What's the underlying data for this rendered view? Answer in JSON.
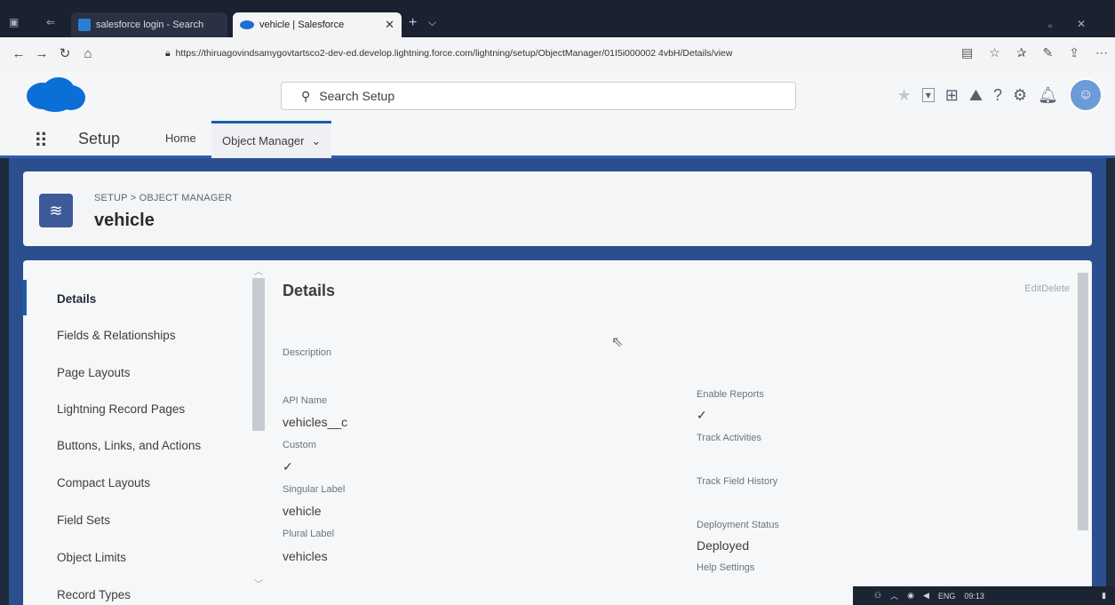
{
  "browser": {
    "tabs": [
      {
        "label": "salesforce login - Search",
        "active": false
      },
      {
        "label": "vehicle | Salesforce",
        "active": true
      }
    ],
    "new_tab": "+",
    "url": "https://thiruagovindsamygovtartsco2-dev-ed.develop.lightning.force.com/lightning/setup/ObjectManager/01I5i000002 4vbH/Details/view"
  },
  "header": {
    "search_placeholder": "Search Setup"
  },
  "nav": {
    "app_title": "Setup",
    "tabs": [
      {
        "label": "Home"
      },
      {
        "label": "Object Manager",
        "active": true
      }
    ]
  },
  "object": {
    "breadcrumb": "SETUP > OBJECT MANAGER",
    "title": "vehicle"
  },
  "sidebar": {
    "items": [
      {
        "label": "Details",
        "active": true
      },
      {
        "label": "Fields & Relationships"
      },
      {
        "label": "Page Layouts"
      },
      {
        "label": "Lightning Record Pages"
      },
      {
        "label": "Buttons, Links, and Actions"
      },
      {
        "label": "Compact Layouts"
      },
      {
        "label": "Field Sets"
      },
      {
        "label": "Object Limits"
      },
      {
        "label": "Record Types"
      }
    ]
  },
  "details": {
    "title": "Details",
    "edit": "Edit",
    "delete": "Delete",
    "description_label": "Description",
    "api_name_label": "API Name",
    "api_name_value": "vehicles__c",
    "custom_label": "Custom",
    "custom_check": "✓",
    "singular_label": "Singular Label",
    "singular_value": "vehicle",
    "plural_label": "Plural Label",
    "plural_value": "vehicles",
    "enable_reports_label": "Enable Reports",
    "enable_reports_check": "✓",
    "track_activities_label": "Track Activities",
    "track_field_history_label": "Track Field History",
    "deployment_status_label": "Deployment Status",
    "deployment_status_value": "Deployed",
    "help_settings_label": "Help Settings"
  },
  "taskbar": {
    "lang": "ENG",
    "time": "09:13"
  }
}
